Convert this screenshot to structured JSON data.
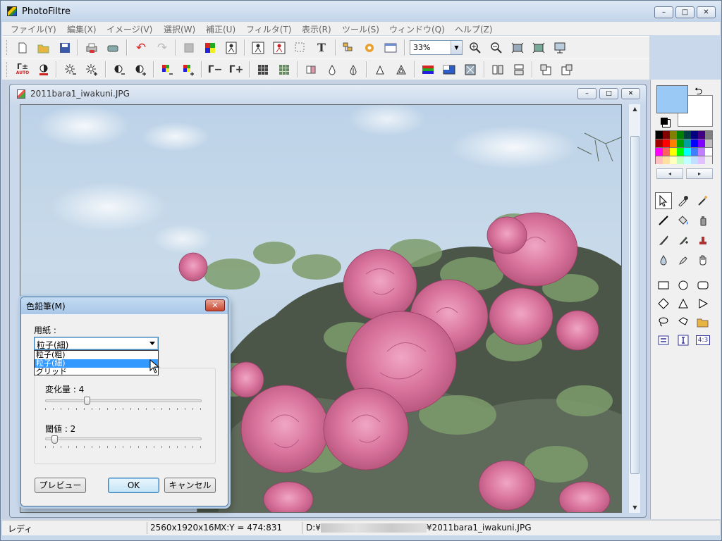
{
  "app": {
    "title": "PhotoFiltre"
  },
  "window_controls": {
    "minimize": "–",
    "maximize": "□",
    "close": "✕"
  },
  "menu": [
    "ファイル(Y)",
    "編集(X)",
    "イメージ(V)",
    "選択(W)",
    "補正(U)",
    "フィルタ(T)",
    "表示(R)",
    "ツール(S)",
    "ウィンドウ(Q)",
    "ヘルプ(Z)"
  ],
  "toolbar": {
    "zoom_value": "33%",
    "icons1": [
      "new-file-icon",
      "open-folder-icon",
      "save-disk-icon",
      "print-icon",
      "scan-icon",
      "undo-icon",
      "redo-icon",
      "gray-square-icon",
      "color-grid-icon",
      "person-icon",
      "person-frame-icon",
      "person-frame-red-icon",
      "selection-icon",
      "text-icon",
      "layers-icon",
      "gear-flower-icon",
      "window-icon",
      "zoom-in-icon",
      "zoom-out-icon",
      "fit-window-icon",
      "fit-image-icon",
      "slideshow-icon"
    ],
    "icons2": [
      "gamma-plus-auto-icon",
      "contrast-auto-icon",
      "brightness-minus-icon",
      "brightness-plus-icon",
      "contrast-minus-icon",
      "contrast-plus-icon",
      "saturation-minus-icon",
      "saturation-plus-icon",
      "gamma-minus-icon",
      "gamma-plus-icon",
      "grid-dark-icon",
      "grid-green-icon",
      "sharpen-icon",
      "drop-icon",
      "drop-double-icon",
      "triangle-icon",
      "triangle-double-icon",
      "gradient-rgb-icon",
      "gradient-blue-icon",
      "special-effect-icon",
      "flip-horizontal-icon",
      "flip-vertical-icon",
      "rotate-left-icon",
      "rotate-right-icon"
    ],
    "undo_glyph": "↶",
    "redo_glyph": "↷",
    "text_glyph": "T",
    "gamma_plus_label": "Γ±",
    "auto_label": "AUTO",
    "gamma_minus_label": "Γ−",
    "gamma_plus2_label": "Γ+"
  },
  "document": {
    "title": "2011bara1_iwakuni.JPG"
  },
  "dialog": {
    "title": "色鉛筆(M)",
    "close_label": "✕",
    "paper_label": "用紙 :",
    "selected": "粒子(細)",
    "options": [
      "粒子(粗)",
      "粒子(細)",
      "グリッド"
    ],
    "selected_index": 1,
    "variation_label": "変化量 : 4",
    "variation_value": 4,
    "threshold_label": "閾値 : 2",
    "threshold_value": 2,
    "preview_button": "プレビュー",
    "ok_button": "OK",
    "cancel_button": "キャンセル"
  },
  "palette_colors": [
    "#000000",
    "#800000",
    "#808000",
    "#008000",
    "#004040",
    "#000080",
    "#400080",
    "#808080",
    "#a00000",
    "#ff0000",
    "#ff8000",
    "#00a000",
    "#00a0a0",
    "#0000ff",
    "#8000ff",
    "#c0c0c0",
    "#ff00ff",
    "#ff6060",
    "#ffff00",
    "#00ff00",
    "#00ffff",
    "#4080ff",
    "#c080ff",
    "#ffffff",
    "#ffc0c0",
    "#ffe0a0",
    "#ffffc0",
    "#c0ffc0",
    "#c0ffff",
    "#c0e0ff",
    "#e0c0ff",
    "#f0f0f0"
  ],
  "colors": {
    "foreground": "#9bc9f5",
    "background": "#ffffff",
    "accent": "#3399ff"
  },
  "status": {
    "state": "レディ",
    "size": "2560x1920x16M",
    "coords": "X:Y = 474:831",
    "path_prefix": "D:¥",
    "path_suffix": "¥2011bara1_iwakuni.JPG"
  },
  "tools": [
    "pointer-icon",
    "eyedropper-icon",
    "magic-wand-icon",
    "line-icon",
    "fill-bucket-icon",
    "spray-icon",
    "brush-icon",
    "brush-plus-icon",
    "stamp-icon",
    "blur-drop-icon",
    "smudge-icon",
    "hand-icon",
    "rectangle-icon",
    "ellipse-icon",
    "rounded-rect-icon",
    "diamond-icon",
    "triangle-shape-icon",
    "arrow-shape-icon",
    "lasso-icon",
    "polygon-lasso-icon",
    "open-shape-icon",
    "horizontal-select-icon",
    "vertical-select-icon",
    "aspect-ratio-icon"
  ],
  "tools_glyphs": {
    "ratio": "4:3"
  }
}
